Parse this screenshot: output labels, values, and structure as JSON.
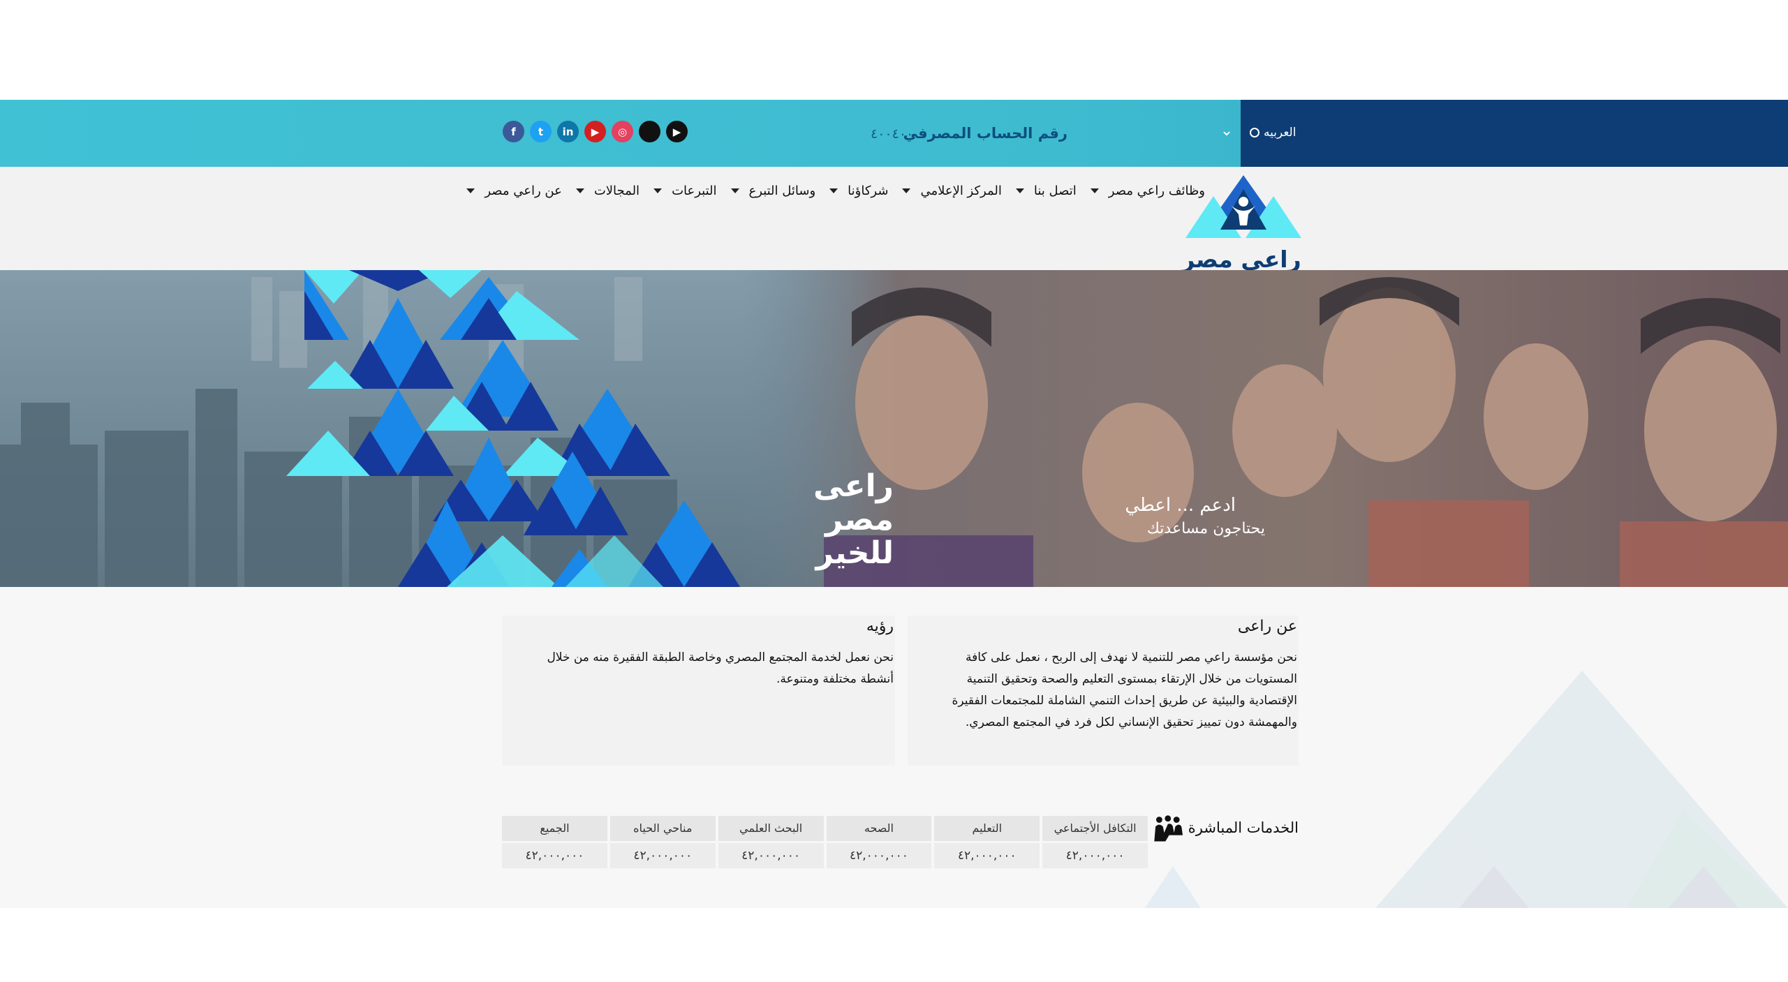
{
  "topbar": {
    "language": "العربيه",
    "bank_account_label": "رقم الحساب المصرفي",
    "bank_account_number": "٤٠٠٤٠٠",
    "social": [
      {
        "name": "facebook",
        "glyph": "f",
        "color": "#3b5998"
      },
      {
        "name": "twitter",
        "glyph": "t",
        "color": "#1da1f2"
      },
      {
        "name": "linkedin",
        "glyph": "in",
        "color": "#0e76a8"
      },
      {
        "name": "youtube",
        "glyph": "▶",
        "color": "#d32121"
      },
      {
        "name": "instagram",
        "glyph": "◎",
        "color": "#e4405f"
      },
      {
        "name": "apple",
        "glyph": "",
        "color": "#111111"
      },
      {
        "name": "google-play",
        "glyph": "▶",
        "color": "#111111"
      }
    ]
  },
  "nav": {
    "items": [
      "عن راعي مصر",
      "المجالات",
      "التبرعات",
      "وسائل التبرع",
      "شركاؤنا",
      "المركز الإعلامي",
      "اتصل بنا",
      "وظائف راعي مصر"
    ]
  },
  "logo": {
    "text": "راعى مصر"
  },
  "hero": {
    "brand_line1": "راعى مصر",
    "brand_line2": "للخير",
    "slogan_line1": "ادعم ... اعطي",
    "slogan_line2": "يحتاجون مساعدتك"
  },
  "about": {
    "title": "عن راعى",
    "body": "نحن مؤسسة راعي مصر للتنمية لا نهدف إلى الربح ، نعمل على كافة المستويات من خلال الإرتقاء بمستوى التعليم والصحة وتحقيق التنمية الإقتصادية والبيئية عن طريق إحداث التنمي الشاملة للمجتمعات الفقيرة والمهمشة دون تمييز تحقيق الإنساني لكل فرد في المجتمع المصري."
  },
  "vision": {
    "title": "رؤيه",
    "body": "نحن نعمل لخدمة المجتمع المصري وخاصة الطبقة الفقيرة منه من خلال أنشطة مختلفة ومتنوعة."
  },
  "services": {
    "title": "الخدمات المباشرة",
    "items": [
      {
        "label": "التكافل الأجتماعي",
        "value": "٤٢,٠٠٠,٠٠٠"
      },
      {
        "label": "التعليم",
        "value": "٤٢,٠٠٠,٠٠٠"
      },
      {
        "label": "الصحه",
        "value": "٤٢,٠٠٠,٠٠٠"
      },
      {
        "label": "البحث العلمي",
        "value": "٤٢,٠٠٠,٠٠٠"
      },
      {
        "label": "مناحي الحياه",
        "value": "٤٢,٠٠٠,٠٠٠"
      },
      {
        "label": "الجميع",
        "value": "٤٢,٠٠٠,٠٠٠"
      }
    ]
  },
  "colors": {
    "topbar": "#40c1d4",
    "lang_bg": "#0d3d74",
    "navy": "#0d3d74",
    "cyan": "#5ee9f5",
    "blue": "#1a88e8",
    "dark_blue": "#16389a"
  }
}
